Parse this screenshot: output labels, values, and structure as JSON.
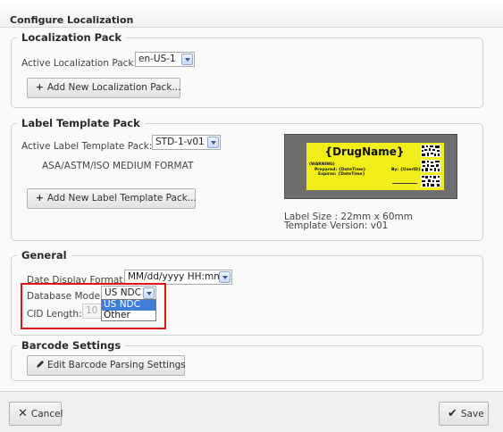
{
  "window": {
    "title": "Configure Localization"
  },
  "localization_pack": {
    "legend": "Localization Pack",
    "active_label": "Active Localization Pack:",
    "active_value": "en-US-1",
    "add_button": "Add New Localization Pack...",
    "add_icon": "+"
  },
  "label_template_pack": {
    "legend": "Label Template Pack",
    "active_label": "Active Label Template Pack:",
    "active_value": "STD-1-v01",
    "format_name": "ASA/ASTM/ISO MEDIUM FORMAT",
    "add_button": "Add New Label Template Pack...",
    "add_icon": "+",
    "preview": {
      "drug_name": "{DrugName}",
      "warning": "(WARNING)",
      "prepared": "Prepared: {DateTime}",
      "expires": "Expires: {DateTime}",
      "by": "By: {UserID}",
      "label_color": "#f1ee19",
      "background_color": "#6f6f6f"
    },
    "label_size": "Label Size :  22mm x 60mm",
    "template_version": "Template Version:  v01"
  },
  "general": {
    "legend": "General",
    "date_format_label": "Date Display Format:",
    "date_format_value": "MM/dd/yyyy HH:mm",
    "database_mode_label": "Database Mode:",
    "database_mode_value": "US NDC",
    "database_mode_options": [
      "US NDC",
      "Other"
    ],
    "cid_length_label": "CID Length:",
    "cid_length_value": "10",
    "highlight_color": "#e01515"
  },
  "barcode_settings": {
    "legend": "Barcode Settings",
    "edit_button": "Edit Barcode Parsing Settings",
    "edit_icon": "pencil-icon"
  },
  "footer": {
    "cancel_label": "Cancel",
    "cancel_icon": "x-icon",
    "save_label": "Save",
    "save_icon": "checkmark-icon"
  }
}
